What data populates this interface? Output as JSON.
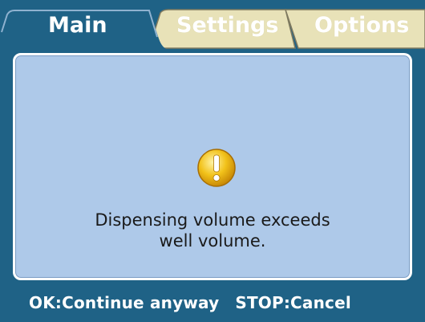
{
  "tabs": [
    {
      "label": "Main",
      "active": true
    },
    {
      "label": "Settings",
      "active": false
    },
    {
      "label": "Options",
      "active": false
    }
  ],
  "dialog": {
    "icon": "warning-exclamation-icon",
    "message_line1": "Dispensing volume exceeds",
    "message_line2": "well volume."
  },
  "footer": {
    "ok_label": "OK:Continue anyway",
    "stop_label": "STOP:Cancel"
  },
  "colors": {
    "background": "#1f6286",
    "dialog_bg": "#aec9e9",
    "inactive_tab": "#e8e2b8",
    "icon_yellow": "#f2c21a"
  }
}
